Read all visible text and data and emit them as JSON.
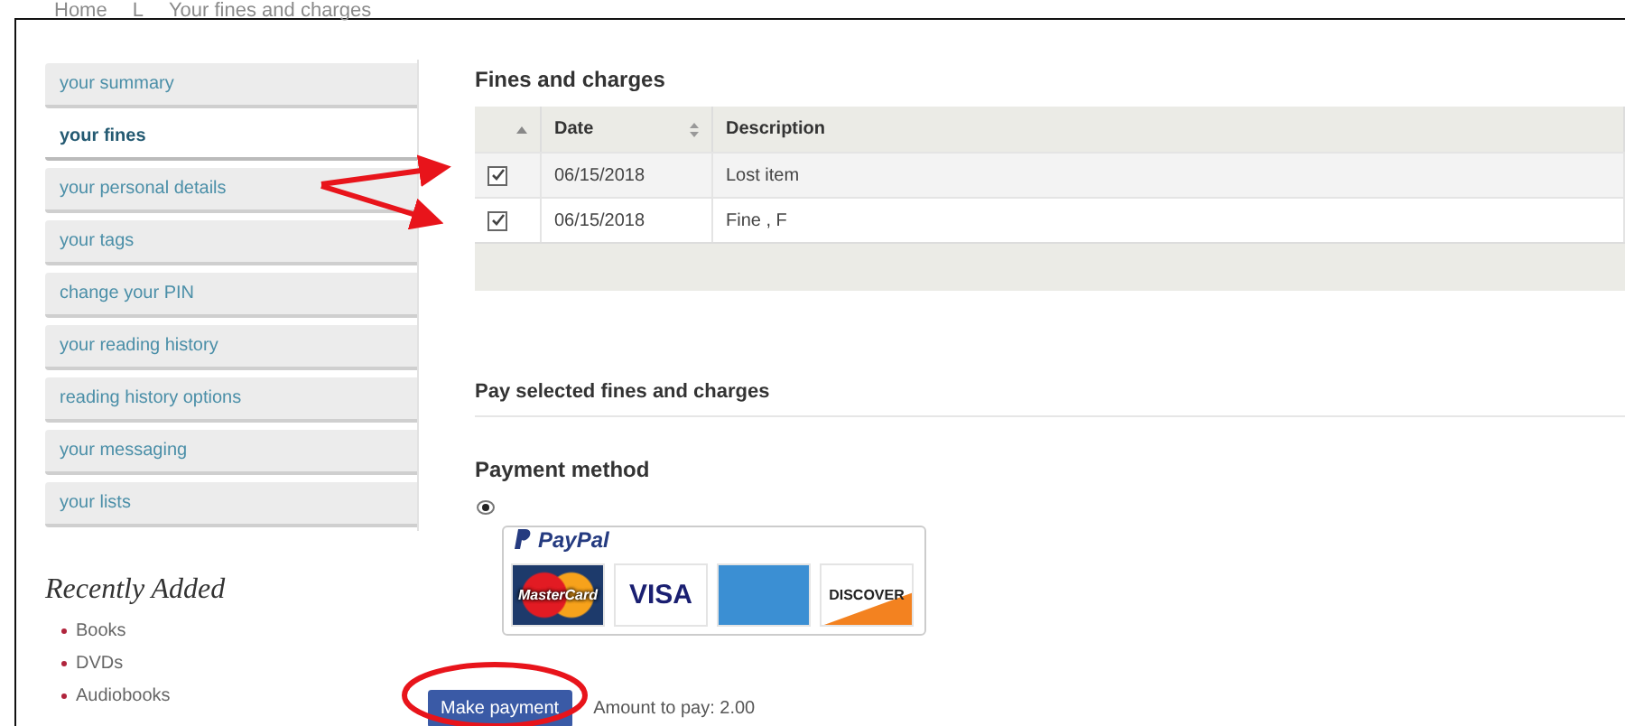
{
  "breadcrumb": [
    "Home",
    "L",
    "Your fines and charges"
  ],
  "sidebar": {
    "items": [
      {
        "label": "your summary",
        "selected": false
      },
      {
        "label": "your fines",
        "selected": true
      },
      {
        "label": "your personal details",
        "selected": false
      },
      {
        "label": "your tags",
        "selected": false
      },
      {
        "label": "change your PIN",
        "selected": false
      },
      {
        "label": "your reading history",
        "selected": false
      },
      {
        "label": "reading history options",
        "selected": false
      },
      {
        "label": "your messaging",
        "selected": false
      },
      {
        "label": "your lists",
        "selected": false
      }
    ]
  },
  "recently_added": {
    "title": "Recently Added",
    "items": [
      "Books",
      "DVDs",
      "Audiobooks"
    ]
  },
  "fines": {
    "title": "Fines and charges",
    "columns": [
      "Date",
      "Description"
    ],
    "rows": [
      {
        "checked": true,
        "date": "06/15/2018",
        "description": "Lost item"
      },
      {
        "checked": true,
        "date": "06/15/2018",
        "description": "Fine , F"
      }
    ]
  },
  "payment": {
    "title": "Pay selected fines and charges",
    "method_title": "Payment method",
    "method_selected": true,
    "provider": "PayPal",
    "cards": [
      {
        "kind": "mastercard",
        "label": "MasterCard"
      },
      {
        "kind": "visa",
        "label": "VISA"
      },
      {
        "kind": "amex"
      },
      {
        "kind": "discover",
        "label": "DISCOVER"
      }
    ],
    "button": "Make payment",
    "amount": "Amount to pay: 2.00"
  }
}
